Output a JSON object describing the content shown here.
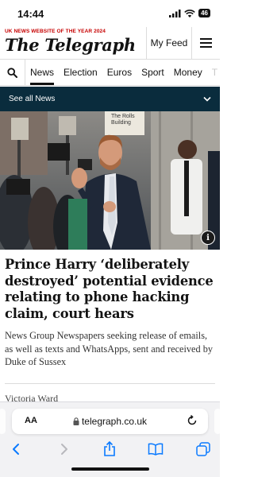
{
  "status_bar": {
    "time": "14:44",
    "battery": "46"
  },
  "masthead": {
    "tagline": "UK NEWS WEBSITE OF THE YEAR 2024",
    "logo": "The Telegraph",
    "my_feed_label": "My Feed"
  },
  "nav": {
    "items": [
      "News",
      "Election",
      "Euros",
      "Sport",
      "Money",
      "T"
    ],
    "active": "News"
  },
  "see_all": {
    "label": "See all News"
  },
  "hero": {
    "sign_text": "The Rolls\nBuilding",
    "info_label": "i"
  },
  "article": {
    "headline": "Prince Harry ‘deliberately destroyed’ potential evidence relating to phone hacking claim, court hears",
    "standfirst": "News Group Newspapers seeking release of emails, as well as texts and WhatsApps, sent and received by Duke of Sussex",
    "author": "Victoria Ward"
  },
  "browser": {
    "text_size_label": "AA",
    "url": "telegraph.co.uk"
  },
  "colors": {
    "accent_red": "#c70000",
    "nav_dark": "#0a2c3d",
    "ios_blue": "#0a7aff"
  }
}
